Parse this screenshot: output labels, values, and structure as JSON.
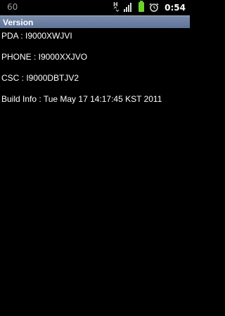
{
  "status_bar": {
    "left_text": "60",
    "time": "0:54",
    "icons": [
      "data-hsdpa-icon",
      "signal-icon",
      "battery-icon",
      "alarm-icon"
    ]
  },
  "title_bar": {
    "title": "Version"
  },
  "info": {
    "pda": "PDA : I9000XWJVI",
    "phone": "PHONE : I9000XXJVO",
    "csc": "CSC : I9000DBTJV2",
    "build": "Build Info : Tue May 17 14:17:45 KST 2011"
  },
  "colors": {
    "title_bar": "#6b7ea3",
    "background": "#000000",
    "text": "#ffffff"
  }
}
